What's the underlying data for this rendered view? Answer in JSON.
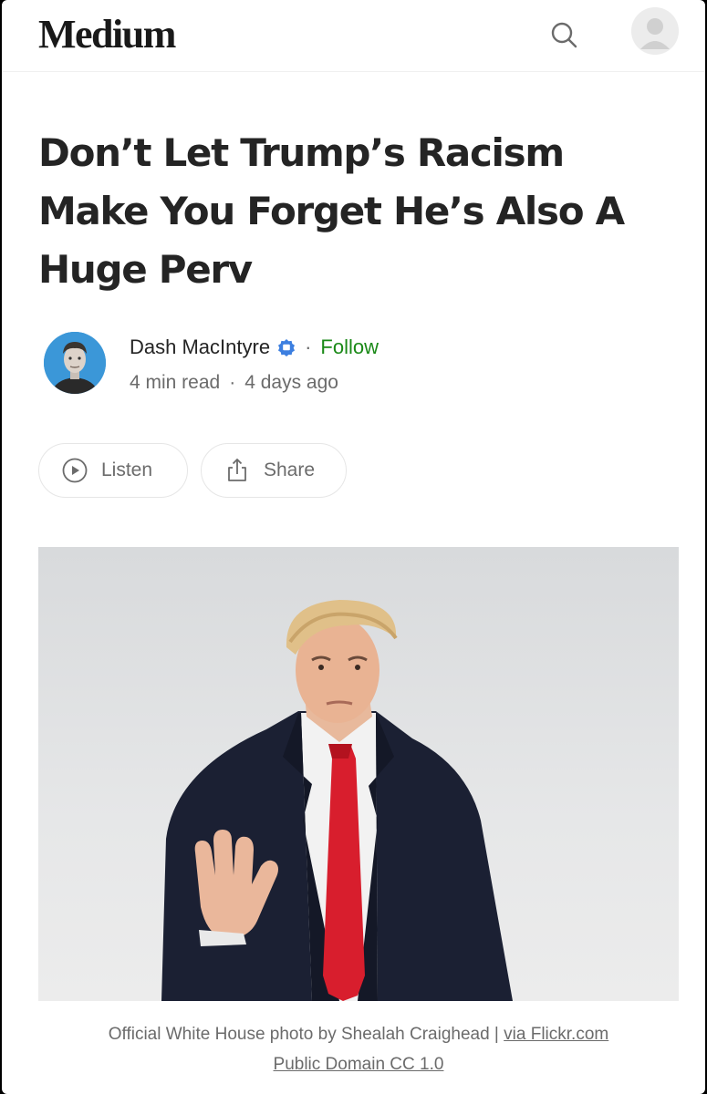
{
  "header": {
    "logo_text": "Medium",
    "search_icon": "search-icon",
    "profile_icon": "user-avatar-icon"
  },
  "article": {
    "title": "Don’t Let Trump’s Racism Make You Forget He’s Also A Huge Perv",
    "author": {
      "name": "Dash MacIntyre",
      "badge_icon": "verified-badge-icon",
      "badge_color": "#3d7fe0",
      "follow_label": "Follow",
      "follow_color": "#1a8917"
    },
    "read_time": "4 min read",
    "published": "4 days ago",
    "separator": "·"
  },
  "actions": {
    "listen_label": "Listen",
    "listen_icon": "play-circle-icon",
    "share_label": "Share",
    "share_icon": "share-icon"
  },
  "caption": {
    "prefix": "Official White House photo by Shealah Craighead | ",
    "link1": "via Flickr.com",
    "link2": "Public Domain CC 1.0"
  }
}
